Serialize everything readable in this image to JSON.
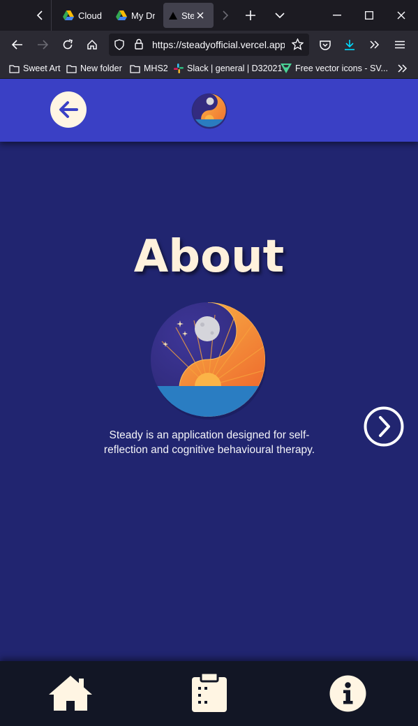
{
  "browser": {
    "tabs": [
      {
        "label": "Cloud",
        "icon": "google-drive-icon",
        "active": false
      },
      {
        "label": "My Dr",
        "icon": "google-drive-icon",
        "active": false
      },
      {
        "label": "Ste",
        "icon": "vercel-icon",
        "active": true
      }
    ],
    "url": "https://steadyofficial.vercel.app/",
    "bookmarks": [
      {
        "label": "Sweet Art",
        "icon": "folder-icon"
      },
      {
        "label": "New folder",
        "icon": "folder-icon"
      },
      {
        "label": "MHS2",
        "icon": "folder-icon"
      },
      {
        "label": "Slack | general | D32021",
        "icon": "slack-icon"
      },
      {
        "label": "Free vector icons - SV...",
        "icon": "flaticon-icon"
      }
    ]
  },
  "app": {
    "title": "About",
    "description": "Steady is an application designed for self-reflection and cognitive behavioural therapy.",
    "colors": {
      "header": "#3a40c5",
      "background": "#212570",
      "bottom_nav": "#121625",
      "accent_cream": "#fff5e3"
    },
    "nav": [
      {
        "name": "home",
        "icon": "home-icon"
      },
      {
        "name": "journal",
        "icon": "clipboard-icon"
      },
      {
        "name": "info",
        "icon": "info-icon"
      }
    ]
  }
}
